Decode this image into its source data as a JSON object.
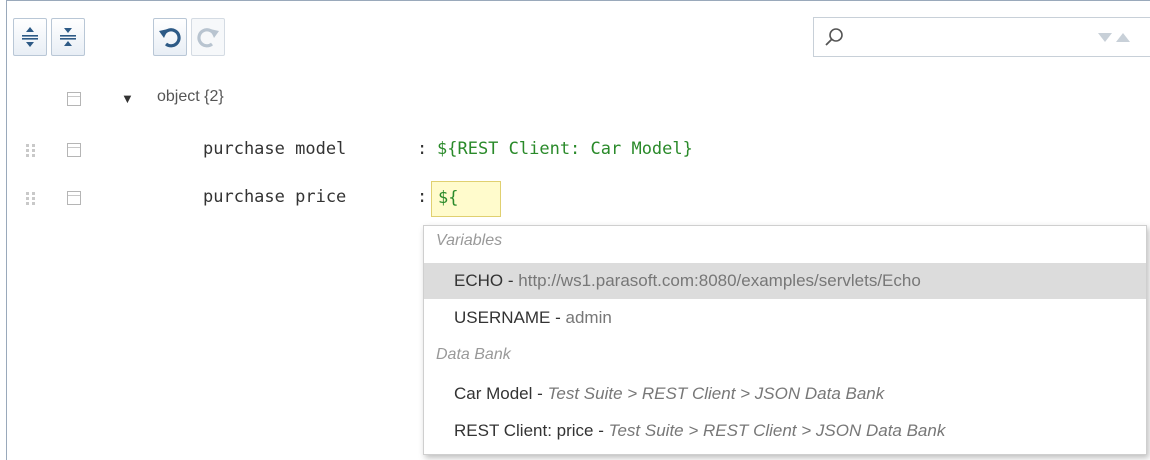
{
  "toolbar": {
    "expand_all": "expand-all-icon",
    "collapse_all": "collapse-all-icon",
    "undo": "undo-icon",
    "redo": "redo-icon"
  },
  "search": {
    "value": "",
    "placeholder": ""
  },
  "tree": {
    "root_label": "object",
    "root_count": "{2}",
    "rows": [
      {
        "key": "purchase model",
        "separator": ":",
        "value": "${REST Client: Car Model}"
      },
      {
        "key": "purchase price",
        "separator": ":",
        "value": "${"
      }
    ]
  },
  "autocomplete": {
    "sections": [
      {
        "header": "Variables",
        "items": [
          {
            "name": "ECHO",
            "separator": "-",
            "detail": "http://ws1.parasoft.com:8080/examples/servlets/Echo",
            "selected": true
          },
          {
            "name": "USERNAME",
            "separator": "-",
            "detail": "admin",
            "selected": false
          }
        ]
      },
      {
        "header": "Data Bank",
        "items": [
          {
            "name": "Car Model",
            "separator": "-",
            "detail": "Test Suite > REST Client > JSON Data Bank",
            "selected": false
          },
          {
            "name": "REST Client: price",
            "separator": "-",
            "detail": "Test Suite > REST Client > JSON Data Bank",
            "selected": false
          }
        ]
      }
    ]
  },
  "colors": {
    "value_green": "#2a8a2a",
    "selection_gray": "#dcdcdc",
    "input_highlight": "#fffbcc",
    "button_icon_blue": "#2d5a86"
  }
}
